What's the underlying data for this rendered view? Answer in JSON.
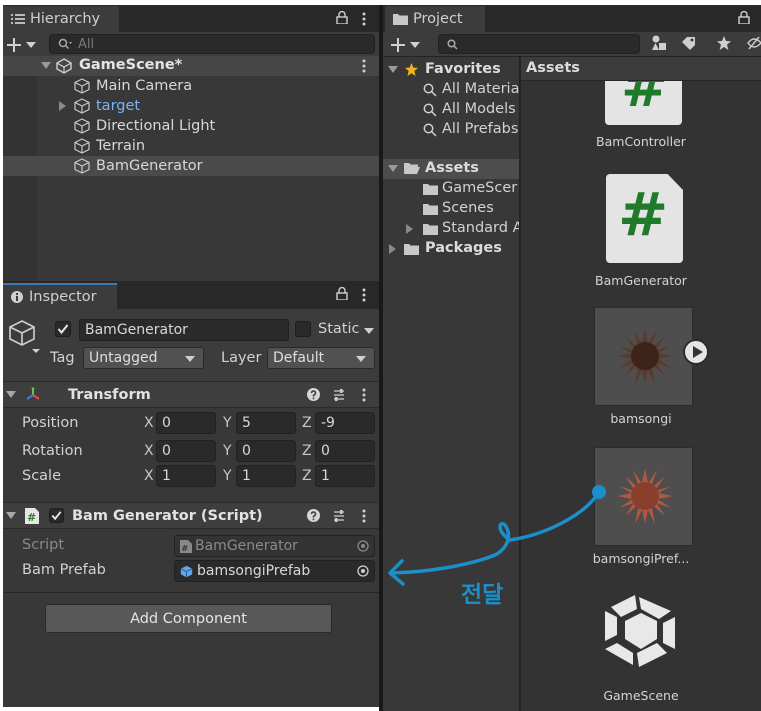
{
  "hierarchy": {
    "tab_label": "Hierarchy",
    "search_placeholder": "All",
    "scene_name": "GameScene*",
    "items": [
      {
        "label": "Main Camera"
      },
      {
        "label": "target"
      },
      {
        "label": "Directional Light"
      },
      {
        "label": "Terrain"
      },
      {
        "label": "BamGenerator"
      }
    ]
  },
  "inspector": {
    "tab_label": "Inspector",
    "object_name": "BamGenerator",
    "static_label": "Static",
    "tag_label": "Tag",
    "tag_value": "Untagged",
    "layer_label": "Layer",
    "layer_value": "Default",
    "transform": {
      "title": "Transform",
      "position_label": "Position",
      "rotation_label": "Rotation",
      "scale_label": "Scale",
      "x": "X",
      "y": "Y",
      "z": "Z",
      "position": [
        "0",
        "5",
        "-9"
      ],
      "rotation": [
        "0",
        "0",
        "0"
      ],
      "scale": [
        "1",
        "1",
        "1"
      ]
    },
    "script_component": {
      "title": "Bam Generator (Script)",
      "script_label": "Script",
      "script_value": "BamGenerator",
      "prefab_label": "Bam Prefab",
      "prefab_value": "bamsongiPrefab"
    },
    "add_component": "Add Component"
  },
  "project": {
    "tab_label": "Project",
    "favorites": "Favorites",
    "favorite_items": [
      "All Materia",
      "All Models",
      "All Prefabs"
    ],
    "assets": "Assets",
    "asset_folders": [
      "GameScer",
      "Scenes",
      "Standard A"
    ],
    "packages": "Packages",
    "breadcrumb": "Assets",
    "grid_items": [
      {
        "label": "BamController"
      },
      {
        "label": "BamGenerator"
      },
      {
        "label": "bamsongi"
      },
      {
        "label": "bamsongiPref..."
      },
      {
        "label": "GameScene"
      }
    ]
  },
  "annotation": {
    "text": "전달",
    "color": "#1b8fc9"
  }
}
